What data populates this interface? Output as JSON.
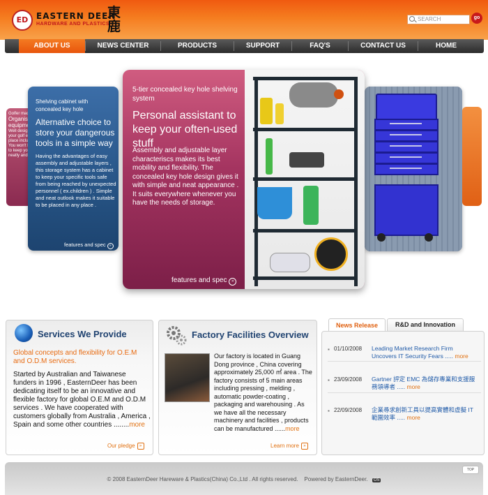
{
  "brand": {
    "logo_text": "ED",
    "title": "EASTERN DEER",
    "subtitle": "HARDWARE AND PLASTICS",
    "chinese": "東鹿"
  },
  "search": {
    "placeholder": "SEARCH",
    "go_label": "go"
  },
  "nav": {
    "items": [
      "ABOUT US",
      "NEWS CENTER",
      "PRODUCTS",
      "SUPPORT",
      "FAQ'S",
      "CONTACT US",
      "HOME"
    ]
  },
  "carousel": {
    "far_left": {
      "lines": [
        "Golfer made",
        "Organise",
        "equipme",
        "Well design",
        "your golf eq",
        "place includ",
        "You won't b",
        "to keep you",
        "neatly and a"
      ]
    },
    "left": {
      "heading": "Shelving cabinet with concealed key hole",
      "headline": "Alternative choice to store your dangerous tools in a simple way",
      "body": "Having the advantages of easy assembly and adjustable layers , this storage system has a cabinet to keep your specific tools safe from being reached by unexpected personnel ( ex.children ) . Simple and neat outlook makes it suitable to be placed in any place .",
      "link": "features and spec"
    },
    "center": {
      "heading": "5-tier concealed key hole shelving system",
      "headline": "Personal assistant to keep your often-used stuff",
      "body": "Assembly and adjustable layer characteriscs makes its best mobility and flexibility. The concealed key hole design gives it with simple and neat appearance . It suits everywhere whenever you have the needs of storage.",
      "link": "features and spec"
    }
  },
  "services": {
    "title": "Services We Provide",
    "tagline": "Global concepts and flexibility for O.E.M and O.D.M services.",
    "body": "Started by Australian and Taiwanese funders in 1996 , EasternDeer has been dedicating itself to be an innovative and flexible factory for global O.E.M and O.D.M services . We have cooperated with customers globally from Australia , America , Spain and some other countries ........",
    "more": "more",
    "link": "Our pledge"
  },
  "factory": {
    "title": "Factory Facilities Overview",
    "body": "Our factory is located in Guang Dong province , China covering approximately 25,000 ㎡ area . The factory consists of 5 main areas including pressing , melding , automatic powder-coating , packaging and warehousing . As we have all the necessary machinery and facilities , products can be manufactured ......",
    "more": "more",
    "link": "Learn more"
  },
  "news": {
    "tabs": [
      "News Release",
      "R&D and Innovation"
    ],
    "items": [
      {
        "date": "01/10/2008",
        "title": "Leading Market Research Firm Uncovers IT Security Fears .....",
        "more": "more"
      },
      {
        "date": "23/09/2008",
        "title": "Gartner 評定 EMC 為儲存專業和支援服務領導者 .....",
        "more": "more"
      },
      {
        "date": "22/09/2008",
        "title": "企業尋求創新工具以提高實體和虛擬 IT 範圍效率 .....",
        "more": "more"
      }
    ]
  },
  "footer": {
    "copyright": "© 2008 EasternDeer Hareware & Plastics(China) Co.,Ltd . All rights reserved.",
    "powered": "Powered by EasternDeer.",
    "badge": "OS",
    "top": "TOP"
  },
  "colors": {
    "accent": "#f06a14",
    "nav_bg": "#3a3a3a",
    "link_blue": "#1f5aa8",
    "more_orange": "#e07010"
  }
}
